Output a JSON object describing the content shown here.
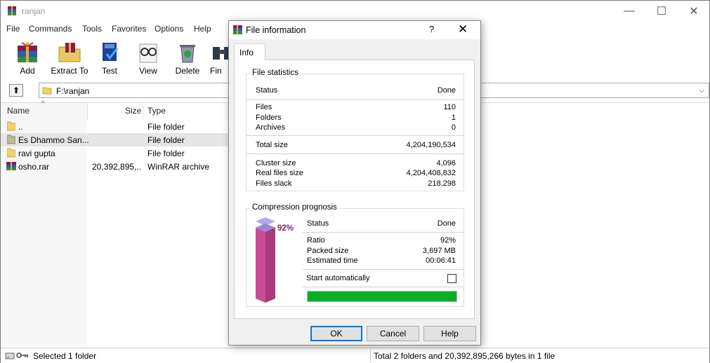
{
  "window": {
    "title": "ranjan",
    "controls": {
      "minimize": "—",
      "maximize": "☐",
      "close": "✕"
    }
  },
  "menu": [
    "File",
    "Commands",
    "Tools",
    "Favorites",
    "Options",
    "Help"
  ],
  "toolbar": [
    {
      "label": "Add",
      "icon": "add-archive-icon"
    },
    {
      "label": "Extract To",
      "icon": "extract-to-icon"
    },
    {
      "label": "Test",
      "icon": "test-icon"
    },
    {
      "label": "View",
      "icon": "view-icon"
    },
    {
      "label": "Delete",
      "icon": "delete-icon"
    },
    {
      "label": "Fin",
      "icon": "find-icon"
    }
  ],
  "address": {
    "path": "F:\\ranjan",
    "up_glyph": "⬆",
    "dropdown_glyph": "⌵"
  },
  "columns": {
    "name": "Name",
    "size": "Size",
    "type": "Type",
    "sort_glyph": "^"
  },
  "files": [
    {
      "name": "..",
      "size": "",
      "type": "File folder",
      "icon": "folder-icon",
      "selected": false
    },
    {
      "name": "Es Dhammo San...",
      "size": "",
      "type": "File folder",
      "icon": "folder-icon",
      "selected": true
    },
    {
      "name": "ravi gupta",
      "size": "",
      "type": "File folder",
      "icon": "folder-icon",
      "selected": false
    },
    {
      "name": "osho.rar",
      "size": "20,392,895,...",
      "type": "WinRAR archive",
      "icon": "rar-archive-icon",
      "selected": false
    }
  ],
  "status": {
    "left": "Selected 1 folder",
    "right": "Total 2 folders and 20,392,895,266 bytes in 1 file"
  },
  "dialog": {
    "title": "File information",
    "help_glyph": "?",
    "close_glyph": "✕",
    "tab": "Info",
    "file_statistics": {
      "title": "File statistics",
      "status_label": "Status",
      "status_value": "Done",
      "files_label": "Files",
      "files_value": "110",
      "folders_label": "Folders",
      "folders_value": "1",
      "archives_label": "Archives",
      "archives_value": "0",
      "total_size_label": "Total size",
      "total_size_value": "4,204,190,534",
      "cluster_size_label": "Cluster size",
      "cluster_size_value": "4,096",
      "real_files_size_label": "Real files size",
      "real_files_size_value": "4,204,408,832",
      "files_slack_label": "Files slack",
      "files_slack_value": "218,298"
    },
    "compression": {
      "title": "Compression prognosis",
      "gauge_percent": "92%",
      "gauge_fraction": 0.92,
      "status_label": "Status",
      "status_value": "Done",
      "ratio_label": "Ratio",
      "ratio_value": "92%",
      "packed_size_label": "Packed size",
      "packed_size_value": "3,697 MB",
      "estimated_time_label": "Estimated time",
      "estimated_time_value": "00:06:41",
      "start_automatically_label": "Start automatically",
      "start_automatically_checked": false,
      "progress_fraction": 1.0
    },
    "buttons": {
      "ok": "OK",
      "cancel": "Cancel",
      "help": "Help"
    }
  }
}
